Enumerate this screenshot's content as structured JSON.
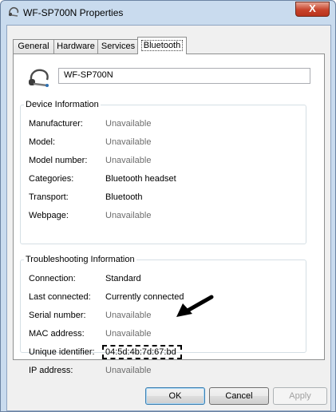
{
  "window": {
    "title": "WF-SP700N Properties",
    "close_label": "X"
  },
  "tabs": [
    {
      "label": "General"
    },
    {
      "label": "Hardware"
    },
    {
      "label": "Services"
    },
    {
      "label": "Bluetooth"
    }
  ],
  "device": {
    "name": "WF-SP700N",
    "icon": "headset-icon"
  },
  "device_info": {
    "legend": "Device Information",
    "rows": [
      {
        "label": "Manufacturer:",
        "value": "Unavailable"
      },
      {
        "label": "Model:",
        "value": "Unavailable"
      },
      {
        "label": "Model number:",
        "value": "Unavailable"
      },
      {
        "label": "Categories:",
        "value": "Bluetooth headset"
      },
      {
        "label": "Transport:",
        "value": "Bluetooth"
      },
      {
        "label": "Webpage:",
        "value": "Unavailable"
      }
    ]
  },
  "troubleshooting": {
    "legend": "Troubleshooting Information",
    "rows": [
      {
        "label": "Connection:",
        "value": "Standard"
      },
      {
        "label": "Last connected:",
        "value": "Currently connected"
      },
      {
        "label": "Serial number:",
        "value": "Unavailable"
      },
      {
        "label": "MAC address:",
        "value": "Unavailable"
      },
      {
        "label": "Unique identifier:",
        "value": "04:5d:4b:7d:67:bd"
      },
      {
        "label": "IP address:",
        "value": "Unavailable"
      }
    ]
  },
  "buttons": {
    "ok": "OK",
    "cancel": "Cancel",
    "apply": "Apply"
  },
  "colors": {
    "unavailable_text": "#6d6d6d",
    "title_bar": "#c9dbee",
    "close_button": "#c7432b"
  }
}
